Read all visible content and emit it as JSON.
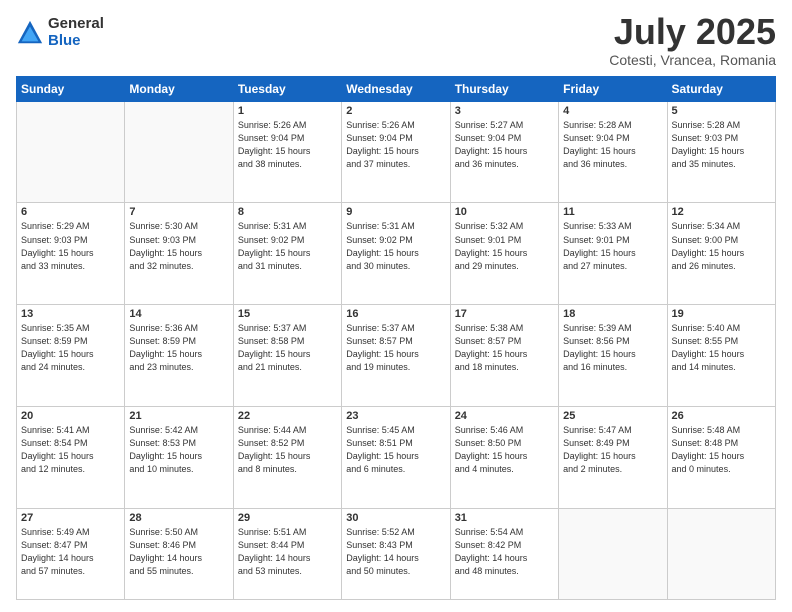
{
  "logo": {
    "general": "General",
    "blue": "Blue"
  },
  "title": {
    "month": "July 2025",
    "location": "Cotesti, Vrancea, Romania"
  },
  "weekdays": [
    "Sunday",
    "Monday",
    "Tuesday",
    "Wednesday",
    "Thursday",
    "Friday",
    "Saturday"
  ],
  "weeks": [
    [
      {
        "day": "",
        "info": ""
      },
      {
        "day": "",
        "info": ""
      },
      {
        "day": "1",
        "info": "Sunrise: 5:26 AM\nSunset: 9:04 PM\nDaylight: 15 hours\nand 38 minutes."
      },
      {
        "day": "2",
        "info": "Sunrise: 5:26 AM\nSunset: 9:04 PM\nDaylight: 15 hours\nand 37 minutes."
      },
      {
        "day": "3",
        "info": "Sunrise: 5:27 AM\nSunset: 9:04 PM\nDaylight: 15 hours\nand 36 minutes."
      },
      {
        "day": "4",
        "info": "Sunrise: 5:28 AM\nSunset: 9:04 PM\nDaylight: 15 hours\nand 36 minutes."
      },
      {
        "day": "5",
        "info": "Sunrise: 5:28 AM\nSunset: 9:03 PM\nDaylight: 15 hours\nand 35 minutes."
      }
    ],
    [
      {
        "day": "6",
        "info": "Sunrise: 5:29 AM\nSunset: 9:03 PM\nDaylight: 15 hours\nand 33 minutes."
      },
      {
        "day": "7",
        "info": "Sunrise: 5:30 AM\nSunset: 9:03 PM\nDaylight: 15 hours\nand 32 minutes."
      },
      {
        "day": "8",
        "info": "Sunrise: 5:31 AM\nSunset: 9:02 PM\nDaylight: 15 hours\nand 31 minutes."
      },
      {
        "day": "9",
        "info": "Sunrise: 5:31 AM\nSunset: 9:02 PM\nDaylight: 15 hours\nand 30 minutes."
      },
      {
        "day": "10",
        "info": "Sunrise: 5:32 AM\nSunset: 9:01 PM\nDaylight: 15 hours\nand 29 minutes."
      },
      {
        "day": "11",
        "info": "Sunrise: 5:33 AM\nSunset: 9:01 PM\nDaylight: 15 hours\nand 27 minutes."
      },
      {
        "day": "12",
        "info": "Sunrise: 5:34 AM\nSunset: 9:00 PM\nDaylight: 15 hours\nand 26 minutes."
      }
    ],
    [
      {
        "day": "13",
        "info": "Sunrise: 5:35 AM\nSunset: 8:59 PM\nDaylight: 15 hours\nand 24 minutes."
      },
      {
        "day": "14",
        "info": "Sunrise: 5:36 AM\nSunset: 8:59 PM\nDaylight: 15 hours\nand 23 minutes."
      },
      {
        "day": "15",
        "info": "Sunrise: 5:37 AM\nSunset: 8:58 PM\nDaylight: 15 hours\nand 21 minutes."
      },
      {
        "day": "16",
        "info": "Sunrise: 5:37 AM\nSunset: 8:57 PM\nDaylight: 15 hours\nand 19 minutes."
      },
      {
        "day": "17",
        "info": "Sunrise: 5:38 AM\nSunset: 8:57 PM\nDaylight: 15 hours\nand 18 minutes."
      },
      {
        "day": "18",
        "info": "Sunrise: 5:39 AM\nSunset: 8:56 PM\nDaylight: 15 hours\nand 16 minutes."
      },
      {
        "day": "19",
        "info": "Sunrise: 5:40 AM\nSunset: 8:55 PM\nDaylight: 15 hours\nand 14 minutes."
      }
    ],
    [
      {
        "day": "20",
        "info": "Sunrise: 5:41 AM\nSunset: 8:54 PM\nDaylight: 15 hours\nand 12 minutes."
      },
      {
        "day": "21",
        "info": "Sunrise: 5:42 AM\nSunset: 8:53 PM\nDaylight: 15 hours\nand 10 minutes."
      },
      {
        "day": "22",
        "info": "Sunrise: 5:44 AM\nSunset: 8:52 PM\nDaylight: 15 hours\nand 8 minutes."
      },
      {
        "day": "23",
        "info": "Sunrise: 5:45 AM\nSunset: 8:51 PM\nDaylight: 15 hours\nand 6 minutes."
      },
      {
        "day": "24",
        "info": "Sunrise: 5:46 AM\nSunset: 8:50 PM\nDaylight: 15 hours\nand 4 minutes."
      },
      {
        "day": "25",
        "info": "Sunrise: 5:47 AM\nSunset: 8:49 PM\nDaylight: 15 hours\nand 2 minutes."
      },
      {
        "day": "26",
        "info": "Sunrise: 5:48 AM\nSunset: 8:48 PM\nDaylight: 15 hours\nand 0 minutes."
      }
    ],
    [
      {
        "day": "27",
        "info": "Sunrise: 5:49 AM\nSunset: 8:47 PM\nDaylight: 14 hours\nand 57 minutes."
      },
      {
        "day": "28",
        "info": "Sunrise: 5:50 AM\nSunset: 8:46 PM\nDaylight: 14 hours\nand 55 minutes."
      },
      {
        "day": "29",
        "info": "Sunrise: 5:51 AM\nSunset: 8:44 PM\nDaylight: 14 hours\nand 53 minutes."
      },
      {
        "day": "30",
        "info": "Sunrise: 5:52 AM\nSunset: 8:43 PM\nDaylight: 14 hours\nand 50 minutes."
      },
      {
        "day": "31",
        "info": "Sunrise: 5:54 AM\nSunset: 8:42 PM\nDaylight: 14 hours\nand 48 minutes."
      },
      {
        "day": "",
        "info": ""
      },
      {
        "day": "",
        "info": ""
      }
    ]
  ]
}
